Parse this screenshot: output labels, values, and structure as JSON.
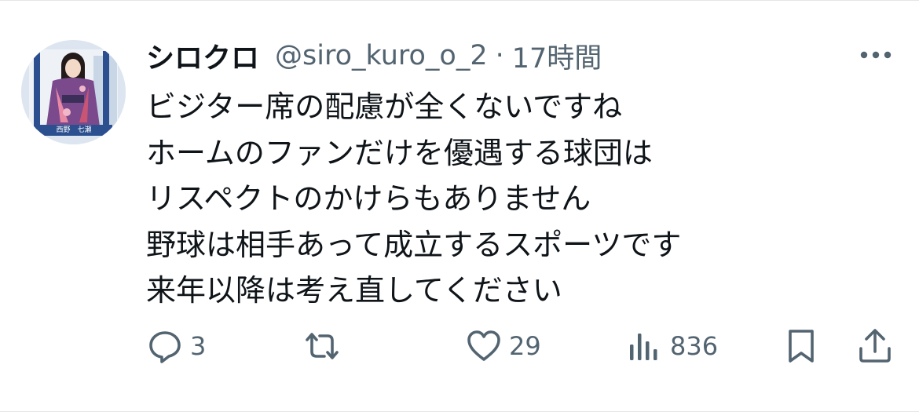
{
  "tweet": {
    "author": {
      "display_name": "シロクロ",
      "handle": "@siro_kuro_o_2",
      "avatar_caption": "西野　七瀬"
    },
    "separator": "·",
    "time": "17時間",
    "text_lines": [
      "ビジター席の配慮が全くないですね",
      "ホームのファンだけを優遇する球団は",
      "リスペクトのかけらもありません",
      "野球は相手あって成立するスポーツです",
      "来年以降は考え直してください"
    ],
    "actions": {
      "reply": {
        "icon": "reply-icon",
        "count": "3"
      },
      "retweet": {
        "icon": "retweet-icon",
        "count": ""
      },
      "like": {
        "icon": "heart-icon",
        "count": "29"
      },
      "views": {
        "icon": "views-icon",
        "count": "836"
      },
      "bookmark": {
        "icon": "bookmark-icon"
      },
      "share": {
        "icon": "share-icon"
      }
    },
    "colors": {
      "text": "#0f1419",
      "secondary": "#536471",
      "border": "#e6e6e6"
    }
  }
}
